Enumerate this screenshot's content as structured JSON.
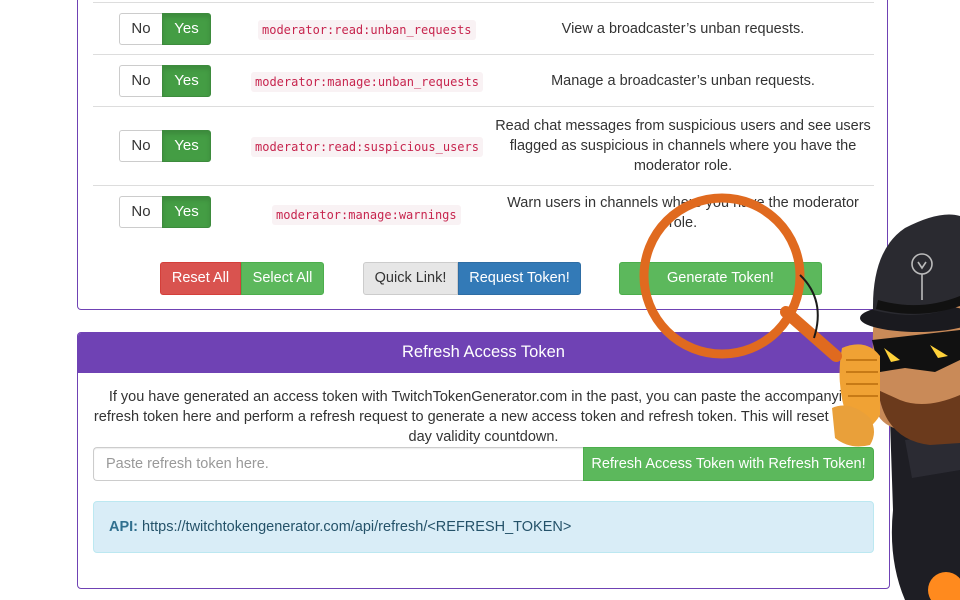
{
  "scopes": [
    {
      "no_label": "No",
      "yes_label": "Yes",
      "code": "moderator:read:unban_requests",
      "description": "View a broadcaster’s unban requests."
    },
    {
      "no_label": "No",
      "yes_label": "Yes",
      "code": "moderator:manage:unban_requests",
      "description": "Manage a broadcaster’s unban requests."
    },
    {
      "no_label": "No",
      "yes_label": "Yes",
      "code": "moderator:read:suspicious_users",
      "description": "Read chat messages from suspicious users and see users flagged as suspicious in channels where you have the moderator role."
    },
    {
      "no_label": "No",
      "yes_label": "Yes",
      "code": "moderator:manage:warnings",
      "description": "Warn users in channels where you have the moderator role."
    }
  ],
  "actions": {
    "reset_all": "Reset All",
    "select_all": "Select All",
    "quick_link": "Quick Link!",
    "request_token": "Request Token!",
    "generate_token": "Generate Token!"
  },
  "refresh": {
    "heading": "Refresh Access Token",
    "description": "If you have generated an access token with TwitchTokenGenerator.com in the past, you can paste the accompanying refresh token here and perform a refresh request to generate a new access token and refresh token. This will reset the 60 day validity countdown.",
    "input_placeholder": "Paste refresh token here.",
    "button_label": "Refresh Access Token with Refresh Token!",
    "api_label": "API:",
    "api_url": "https://twitchtokengenerator.com/api/refresh/<REFRESH_TOKEN>"
  },
  "colors": {
    "panel_purple": "#6f42b4",
    "success_green": "#5cb85c",
    "active_green": "#449d44",
    "danger_red": "#d9534f",
    "primary_blue": "#337ab7",
    "code_pink": "#c7254e",
    "info_bg": "#d9edf7",
    "magnifier_orange": "#e06a1f"
  },
  "overlay": {
    "magnifier_icon": "magnifying-glass",
    "mascot_icon": "cartoon-mascot-with-bowler-hat-and-microphone"
  }
}
